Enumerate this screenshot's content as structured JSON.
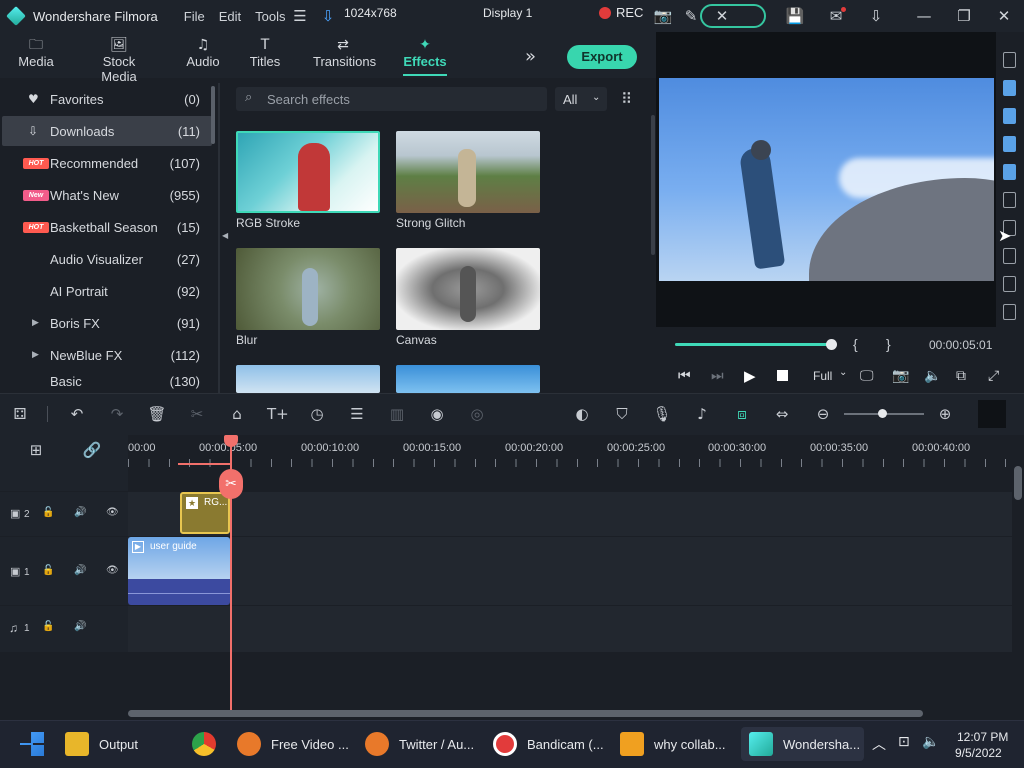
{
  "titlebar": {
    "app_name": "Wondershare Filmora",
    "menus": [
      "File",
      "Edit",
      "Tools"
    ],
    "resolution": "1024x768",
    "display": "Display 1",
    "rec": "REC"
  },
  "nav": {
    "tabs": [
      {
        "label": "Media",
        "icon": "folder-icon"
      },
      {
        "label": "Stock Media",
        "icon": "image-icon"
      },
      {
        "label": "Audio",
        "icon": "music-note-icon"
      },
      {
        "label": "Titles",
        "icon": "text-icon"
      },
      {
        "label": "Transitions",
        "icon": "transition-icon"
      },
      {
        "label": "Effects",
        "icon": "effects-icon"
      }
    ],
    "export_label": "Export"
  },
  "sidebar": {
    "items": [
      {
        "label": "Favorites",
        "count": "(0)",
        "icon": "heart-icon"
      },
      {
        "label": "Downloads",
        "count": "(11)",
        "icon": "download-icon"
      },
      {
        "label": "Recommended",
        "count": "(107)",
        "badge": "HOT"
      },
      {
        "label": "What's New",
        "count": "(955)",
        "badge": "New"
      },
      {
        "label": "Basketball Season",
        "count": "(15)",
        "badge": "HOT"
      },
      {
        "label": "Audio Visualizer",
        "count": "(27)"
      },
      {
        "label": "AI Portrait",
        "count": "(92)"
      },
      {
        "label": "Boris FX",
        "count": "(91)"
      },
      {
        "label": "NewBlue FX",
        "count": "(112)"
      },
      {
        "label": "Basic",
        "count": "(130)"
      }
    ]
  },
  "effects": {
    "search_placeholder": "Search effects",
    "filter_value": "All",
    "items": [
      {
        "label": "RGB Stroke"
      },
      {
        "label": "Strong Glitch"
      },
      {
        "label": "Blur"
      },
      {
        "label": "Canvas"
      }
    ]
  },
  "player": {
    "timecode": "00:00:05:01",
    "quality": "Full",
    "progress": 1.0
  },
  "timeline": {
    "ruler": [
      "00:00",
      "00:00:05:00",
      "00:00:10:00",
      "00:00:15:00",
      "00:00:20:00",
      "00:00:25:00",
      "00:00:30:00",
      "00:00:35:00",
      "00:00:40:00"
    ],
    "tracks": [
      {
        "label": "2",
        "type": "video"
      },
      {
        "label": "1",
        "type": "video"
      },
      {
        "label": "1",
        "type": "audio"
      }
    ],
    "clips": {
      "effect_clip": "RG...",
      "video_clip": "user guide"
    }
  },
  "taskbar": {
    "items": [
      {
        "label": "Output"
      },
      {
        "label": "Free Video ..."
      },
      {
        "label": "Twitter / Au..."
      },
      {
        "label": "Bandicam (..."
      },
      {
        "label": "why collab..."
      },
      {
        "label": "Wondersha..."
      }
    ],
    "time": "12:07 PM",
    "date": "9/5/2022"
  },
  "colors": {
    "accent": "#3fd9b8",
    "hot_badge": "#ff5a50",
    "new_badge": "#f25c8a",
    "playhead": "#f2706b"
  }
}
